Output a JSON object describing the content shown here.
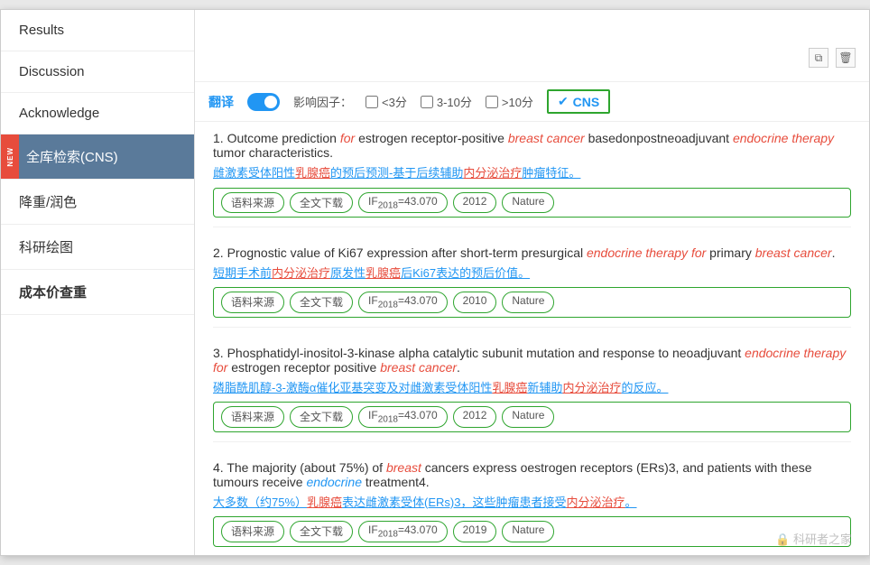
{
  "sidebar": {
    "items": [
      {
        "id": "results",
        "label": "Results",
        "active": false,
        "new": false
      },
      {
        "id": "discussion",
        "label": "Discussion",
        "active": false,
        "new": false
      },
      {
        "id": "acknowledge",
        "label": "Acknowledge",
        "active": false,
        "new": false
      },
      {
        "id": "cns-search",
        "label": "全库检索(CNS)",
        "active": true,
        "new": true
      },
      {
        "id": "recolor",
        "label": "降重/润色",
        "active": false,
        "new": false
      },
      {
        "id": "research-chart",
        "label": "科研绘图",
        "active": false,
        "new": false
      },
      {
        "id": "cost-check",
        "label": "成本价查重",
        "active": false,
        "new": false,
        "bold": true
      }
    ]
  },
  "filter": {
    "translate_label": "翻译",
    "if_label": "影响因子：",
    "opt1": "<3分",
    "opt2": "3-10分",
    "opt3": ">10分",
    "cns_label": "CNS"
  },
  "results": [
    {
      "num": "1",
      "title_parts": [
        {
          "text": "Outcome prediction ",
          "style": "normal"
        },
        {
          "text": "for",
          "style": "italic-red"
        },
        {
          "text": " estrogen receptor-positive ",
          "style": "normal"
        },
        {
          "text": "breast cancer",
          "style": "italic-red"
        },
        {
          "text": " basedonpostneoadjuvant ",
          "style": "normal"
        },
        {
          "text": "endocrine therapy",
          "style": "italic-red"
        },
        {
          "text": " tumor characteristics.",
          "style": "normal"
        }
      ],
      "cn_text": "雌激素受体阳性乳腺癌的预后预测-基于后续辅助内分泌治疗肿瘤特征。",
      "tags": [
        "语料来源",
        "全文下载",
        "IF2018=43.070",
        "2012",
        "Nature"
      ]
    },
    {
      "num": "2",
      "title_parts": [
        {
          "text": "Prognostic value of Ki67 expression after short-term presurgical ",
          "style": "normal"
        },
        {
          "text": "endocrine therapy for",
          "style": "italic-red"
        },
        {
          "text": " primary ",
          "style": "normal"
        },
        {
          "text": "breast cancer",
          "style": "italic-red"
        },
        {
          "text": ".",
          "style": "normal"
        }
      ],
      "cn_text": "短期手术前内分泌治疗原发性乳腺癌后Ki67表达的预后价值。",
      "tags": [
        "语料来源",
        "全文下载",
        "IF2018=43.070",
        "2010",
        "Nature"
      ]
    },
    {
      "num": "3",
      "title_parts": [
        {
          "text": "Phosphatidyl-inositol-3-kinase alpha catalytic subunit mutation and response to neoadjuvant ",
          "style": "normal"
        },
        {
          "text": "endocrine therapy for",
          "style": "italic-red"
        },
        {
          "text": " estrogen receptor positive ",
          "style": "normal"
        },
        {
          "text": "breast cancer",
          "style": "italic-red"
        },
        {
          "text": ".",
          "style": "normal"
        }
      ],
      "cn_text": "磷脂酰肌醇-3-激酶α催化亚基突变及对雌激素受体阳性乳腺癌新辅助内分泌治疗的反应。",
      "tags": [
        "语料来源",
        "全文下载",
        "IF2018=43.070",
        "2012",
        "Nature"
      ]
    },
    {
      "num": "4",
      "title_parts": [
        {
          "text": "The majority (about 75%) of ",
          "style": "normal"
        },
        {
          "text": "breast",
          "style": "italic-red"
        },
        {
          "text": " cancers express oestrogen receptors (ERs)3, and patients with these tumours receive ",
          "style": "normal"
        },
        {
          "text": "endocrine",
          "style": "italic-blue"
        },
        {
          "text": " treatment4.",
          "style": "normal"
        }
      ],
      "cn_text": "大多数（约75%）乳腺癌表达雌激素受体(ERs)3，这些肿瘤患者接受内分泌治疗。",
      "tags": [
        "语料来源",
        "全文下载",
        "IF2018=43.070",
        "2019",
        "Nature"
      ]
    }
  ],
  "watermark": "🔒 科研者之家"
}
